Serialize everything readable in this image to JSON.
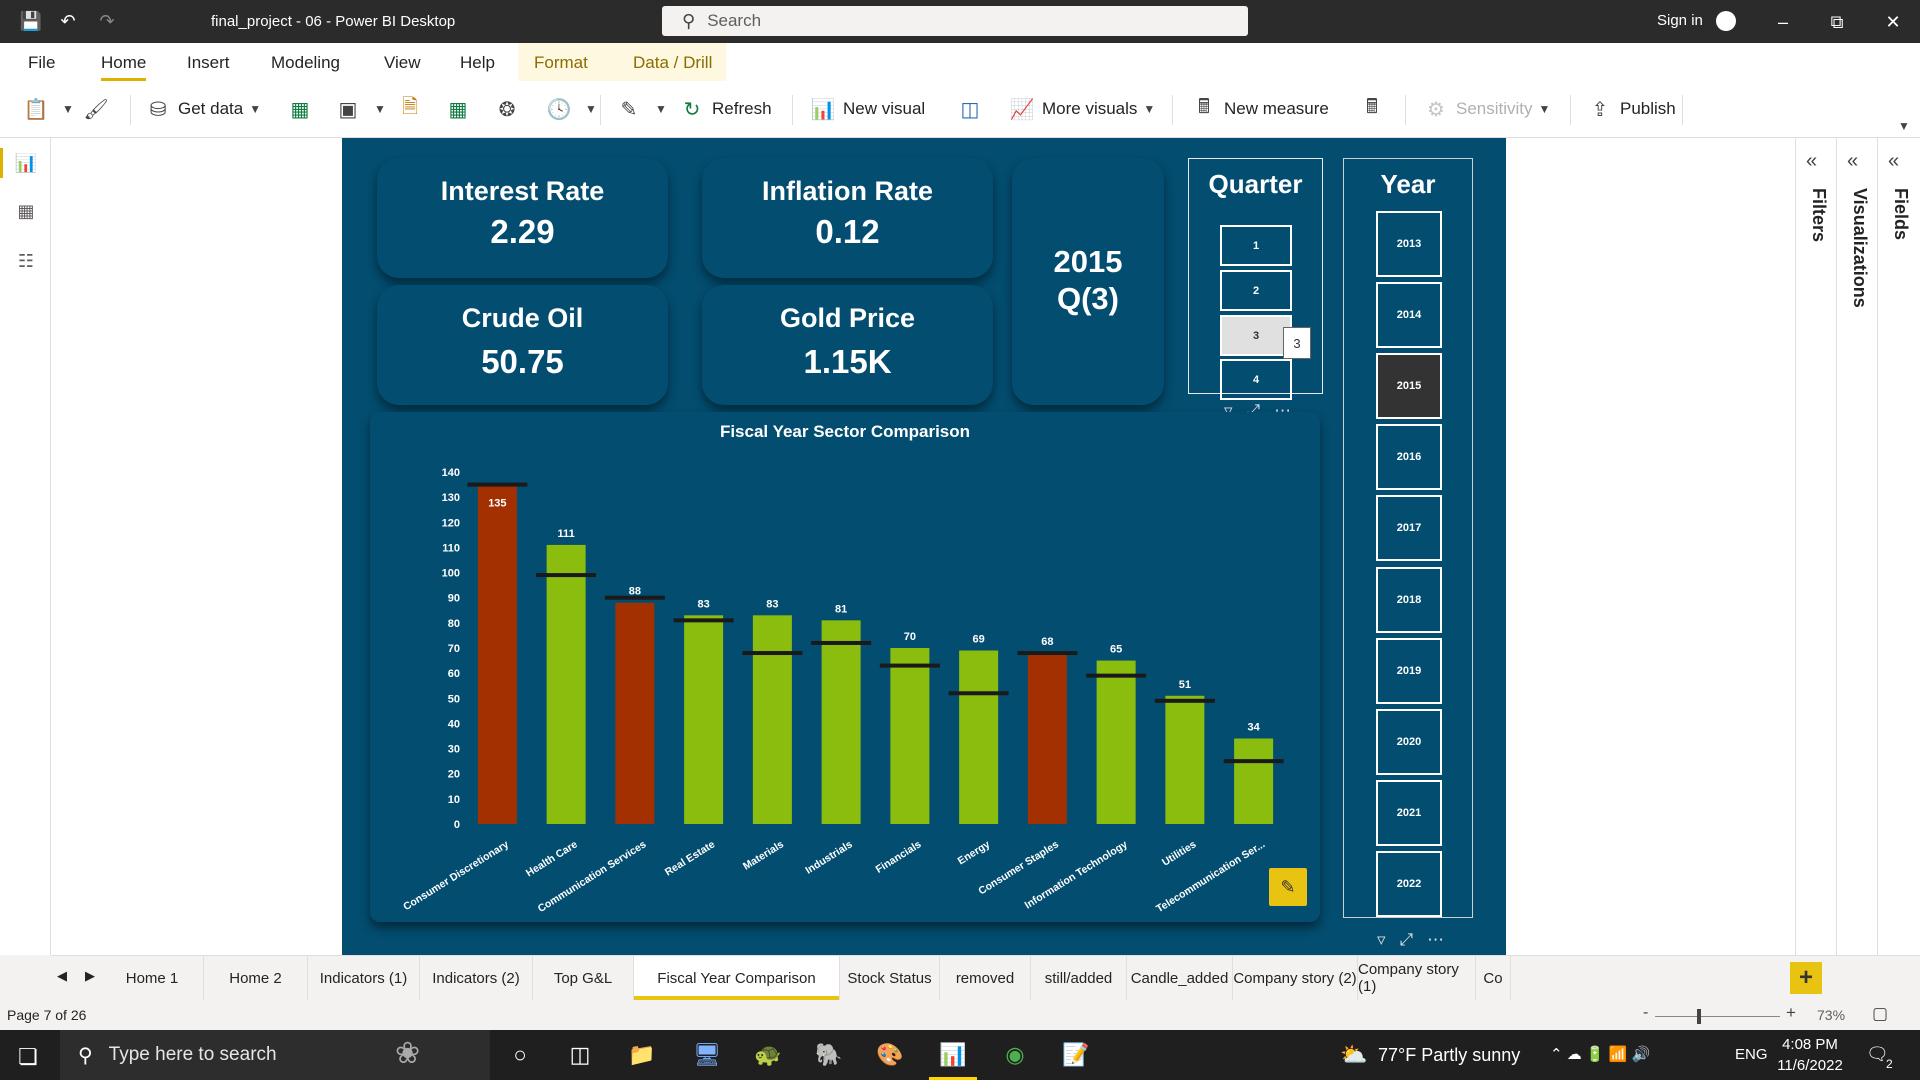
{
  "titlebar": {
    "title": "final_project - 06 - Power BI Desktop",
    "search_placeholder": "Search",
    "sign_in": "Sign in"
  },
  "menu": {
    "tabs": [
      "File",
      "Home",
      "Insert",
      "Modeling",
      "View",
      "Help",
      "Format",
      "Data / Drill"
    ],
    "active": "Home"
  },
  "ribbon": {
    "get_data": "Get data",
    "refresh": "Refresh",
    "new_visual": "New visual",
    "more_visuals": "More visuals",
    "new_measure": "New measure",
    "sensitivity": "Sensitivity",
    "publish": "Publish"
  },
  "cards": {
    "interest_rate": {
      "label": "Interest Rate",
      "value": "2.29"
    },
    "inflation_rate": {
      "label": "Inflation Rate",
      "value": "0.12"
    },
    "crude_oil": {
      "label": "Crude Oil",
      "value": "50.75"
    },
    "gold_price": {
      "label": "Gold Price",
      "value": "1.15K"
    },
    "period": {
      "year": "2015",
      "quarter": "Q(3)"
    }
  },
  "quarter_slicer": {
    "title": "Quarter",
    "options": [
      "1",
      "2",
      "3",
      "4"
    ],
    "selected": "3",
    "tooltip": "3"
  },
  "year_slicer": {
    "title": "Year",
    "options": [
      "2013",
      "2014",
      "2015",
      "2016",
      "2017",
      "2018",
      "2019",
      "2020",
      "2021",
      "2022"
    ],
    "selected": "2015"
  },
  "colors": {
    "report_bg": "#034d70",
    "bar_green": "#8bbd0e",
    "bar_red": "#a33000",
    "target_line": "#1a1a1a",
    "accent_yellow": "#e8c311"
  },
  "chart_data": {
    "type": "bar",
    "title": "Fiscal Year Sector Comparison",
    "xlabel": "",
    "ylabel": "",
    "ylim": [
      0,
      140
    ],
    "yticks": [
      0,
      10,
      20,
      30,
      40,
      50,
      60,
      70,
      80,
      90,
      100,
      110,
      120,
      130,
      140
    ],
    "categories": [
      "Consumer Discretionary",
      "Health Care",
      "Communication Services",
      "Real Estate",
      "Materials",
      "Industrials",
      "Financials",
      "Energy",
      "Consumer Staples",
      "Information Technology",
      "Utilities",
      "Telecommunication Ser..."
    ],
    "values": [
      135,
      111,
      88,
      83,
      83,
      81,
      70,
      69,
      68,
      65,
      51,
      34
    ],
    "targets": [
      135,
      99,
      90,
      81,
      68,
      72,
      63,
      52,
      68,
      59,
      49,
      25
    ],
    "bar_colors": [
      "red",
      "green",
      "red",
      "green",
      "green",
      "green",
      "green",
      "green",
      "red",
      "green",
      "green",
      "green"
    ],
    "grid": false,
    "legend": "none"
  },
  "right_panes": {
    "filters": "Filters",
    "visualizations": "Visualizations",
    "fields": "Fields"
  },
  "page_tabs": {
    "tabs": [
      "Home 1",
      "Home 2",
      "Indicators (1)",
      "Indicators (2)",
      "Top G&L",
      "Fiscal Year Comparison",
      "Stock Status",
      "removed",
      "still/added",
      "Candle_added",
      "Company story (2)",
      "Company story (1)",
      "Co"
    ],
    "active": "Fiscal Year Comparison"
  },
  "status": {
    "page_info": "Page 7 of 26",
    "zoom": "73%"
  },
  "taskbar": {
    "search_placeholder": "Type here to search",
    "weather": "77°F  Partly sunny",
    "lang": "ENG",
    "time": "4:08 PM",
    "date": "11/6/2022",
    "notifications": "2"
  }
}
